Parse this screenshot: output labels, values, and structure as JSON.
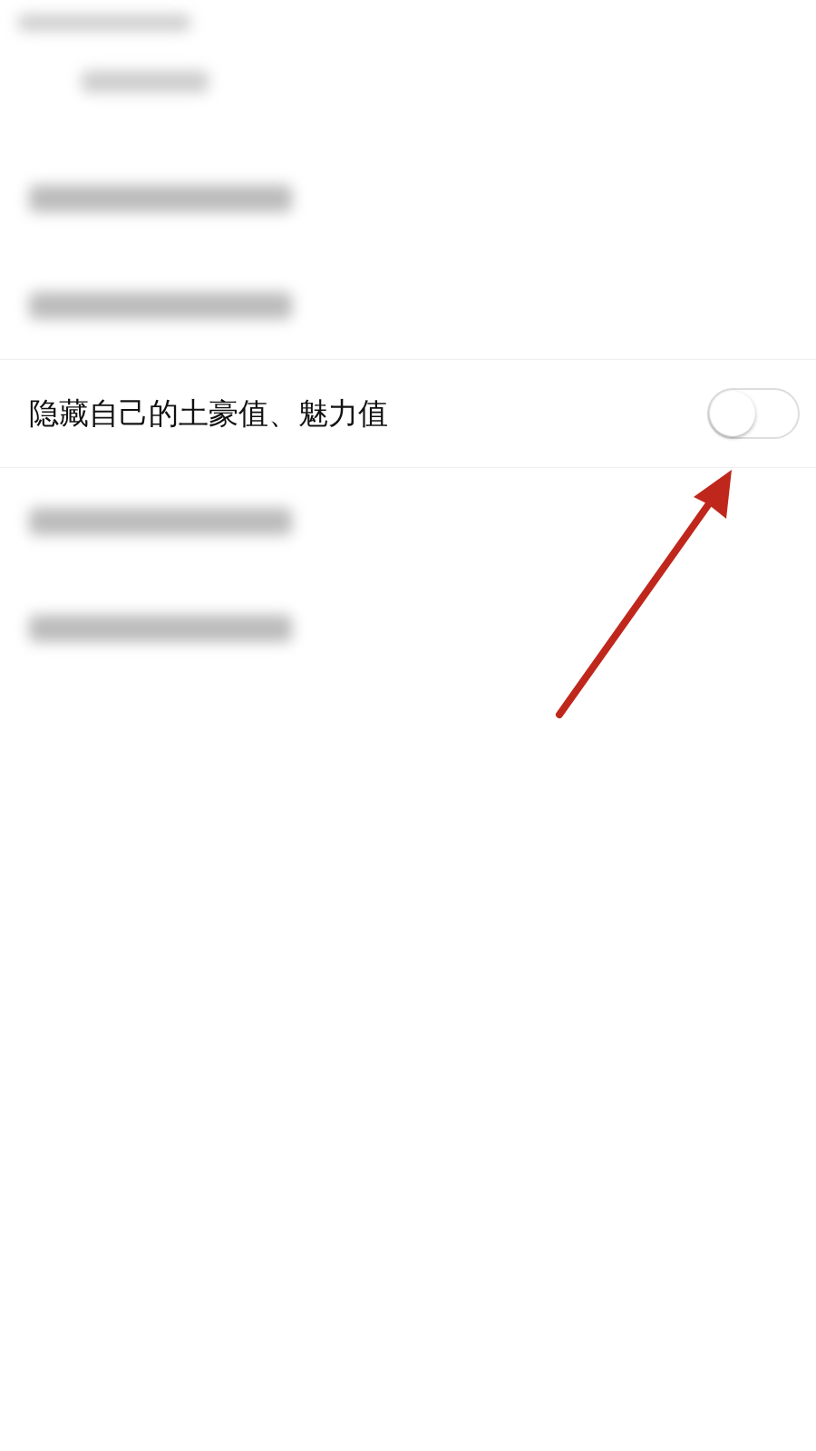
{
  "settings_rows": [
    {
      "kind": "blurred"
    },
    {
      "kind": "blurred"
    },
    {
      "kind": "toggle",
      "label": "隐藏自己的土豪值、魅力值",
      "on": false
    },
    {
      "kind": "blurred"
    },
    {
      "kind": "blurred"
    }
  ]
}
